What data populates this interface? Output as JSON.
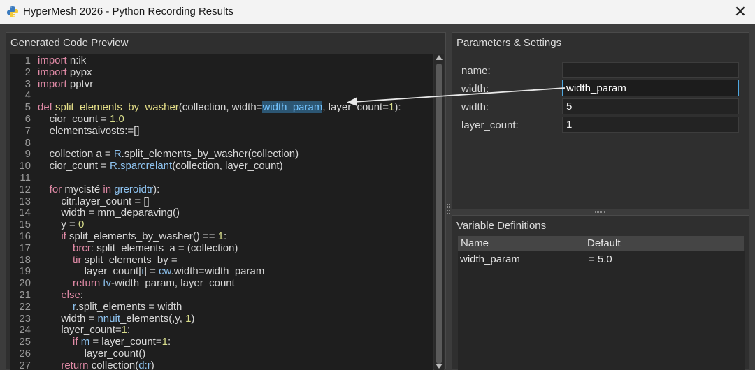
{
  "window": {
    "title": "HyperMesh 2026 - Python Recording Results",
    "close_label": "✕"
  },
  "code_panel": {
    "title": "Generated Code Preview",
    "lines": [
      {
        "n": "1",
        "html": "<span class=\"kw\">import</span> n:ik"
      },
      {
        "n": "2",
        "html": "<span class=\"kw\">import</span> pypx"
      },
      {
        "n": "3",
        "html": "<span class=\"kw\">import</span> pptvr"
      },
      {
        "n": "4",
        "html": ""
      },
      {
        "n": "5",
        "html": "<span class=\"kw\">def</span> <span class=\"fn\">split_elements_by_washer</span>(collection, width=<span class=\"hl\">width_param</span>, layer_count=<span class=\"num\">1</span>):"
      },
      {
        "n": "6",
        "html": "    cior_count = <span class=\"num\">1.0</span>"
      },
      {
        "n": "7",
        "html": "    elementsaivosts:=[]"
      },
      {
        "n": "8",
        "html": ""
      },
      {
        "n": "9",
        "html": "    collection a = <span class=\"var\">R</span>.split_elements_by_washer(collection)"
      },
      {
        "n": "10",
        "html": "    cior_count = <span class=\"var\">R.sparcrelant</span>(collection, layer_count)"
      },
      {
        "n": "11",
        "html": ""
      },
      {
        "n": "12",
        "html": "    <span class=\"kw\">for</span> mycisté <span class=\"kw\">in</span> <span class=\"var\">greroidtr</span>):"
      },
      {
        "n": "13",
        "html": "        citr.layer_count = []"
      },
      {
        "n": "14",
        "html": "        width = mm_deparaving()"
      },
      {
        "n": "15",
        "html": "        y = <span class=\"num\">0</span>"
      },
      {
        "n": "16",
        "html": "        <span class=\"kw\">if</span> split_elements_by_washer() == <span class=\"num\">1</span>:"
      },
      {
        "n": "17",
        "html": "            <span class=\"kw\">brcr</span>: split_elements_a = (collection)"
      },
      {
        "n": "18",
        "html": "            <span class=\"kw\">tir</span> split_elements_by ="
      },
      {
        "n": "19",
        "html": "                layer_count[<span class=\"var\">i</span>] = <span class=\"var\">cw</span>.width=width_param"
      },
      {
        "n": "20",
        "html": "            <span class=\"kw\">return</span> <span class=\"var\">tv</span>-width_param, layer_count"
      },
      {
        "n": "21",
        "html": "        <span class=\"kw\">else</span>:"
      },
      {
        "n": "22",
        "html": "            <span class=\"var\">r</span>.split_elements = width"
      },
      {
        "n": "23",
        "html": "        width = <span class=\"var\">nnuit</span>_elements(,y, <span class=\"num\">1</span>)"
      },
      {
        "n": "24",
        "html": "        layer_count=<span class=\"num\">1</span>:"
      },
      {
        "n": "25",
        "html": "            <span class=\"kw\">if</span> <span class=\"var\">m</span> = layer_count=<span class=\"num\">1</span>:"
      },
      {
        "n": "26",
        "html": "                layer_count()"
      },
      {
        "n": "27",
        "html": "        <span class=\"kw\">return</span> collection(<span class=\"var\">d:r</span>)"
      }
    ]
  },
  "params_panel": {
    "title": "Parameters & Settings",
    "fields": [
      {
        "label": "name:",
        "value": ""
      },
      {
        "label": "width:",
        "value": "width_param"
      },
      {
        "label": "width:",
        "value": "5"
      },
      {
        "label": "layer_count:",
        "value": "1"
      }
    ]
  },
  "vars_panel": {
    "title": "Variable Definitions",
    "headers": {
      "name": "Name",
      "default": "Default"
    },
    "rows": [
      {
        "name": "width_param",
        "default": "= 5.0"
      }
    ]
  },
  "colors": {
    "accent": "#4ea7e0",
    "highlight_bg": "#2c5673",
    "editor_bg": "#1e1e1e"
  },
  "icons": [
    "python-logo-icon",
    "close-icon",
    "scroll-up-icon",
    "scroll-down-icon"
  ]
}
